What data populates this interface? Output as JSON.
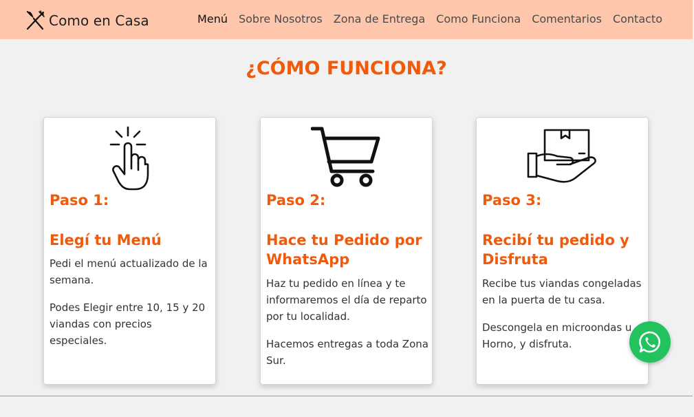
{
  "brand": {
    "name": "Como en Casa",
    "logo_icon": "fork-knife-icon"
  },
  "nav": {
    "items": [
      {
        "label": "Menú",
        "active": true
      },
      {
        "label": "Sobre Nosotros"
      },
      {
        "label": "Zona de Entrega"
      },
      {
        "label": "Como Funciona"
      },
      {
        "label": "Comentarios"
      },
      {
        "label": "Contacto"
      }
    ]
  },
  "section": {
    "title": "¿CÓMO FUNCIONA?"
  },
  "steps": [
    {
      "icon": "tap-hand-icon",
      "step": "Paso 1:",
      "title": "Elegí tu Menú",
      "paragraphs": [
        "Pedi el menú actualizado de la semana.",
        "Podes Elegir entre 10, 15 y 20 viandas con precios especiales."
      ]
    },
    {
      "icon": "shopping-cart-icon",
      "step": "Paso 2:",
      "title": "Hace tu Pedido por WhatsApp",
      "paragraphs": [
        "Haz tu pedido en línea y te informaremos el día de reparto por tu localidad.",
        "Hacemos entregas a toda Zona Sur."
      ]
    },
    {
      "icon": "box-in-hand-icon",
      "step": "Paso 3:",
      "title": "Recibí tu pedido y Disfruta",
      "paragraphs": [
        "Recibe tus viandas congeladas en la puerta de tu casa.",
        "Descongela en microondas u Horno, y disfruta."
      ]
    }
  ],
  "whatsapp": {
    "icon": "whatsapp-icon"
  },
  "colors": {
    "navbar": "#fec7ab",
    "accent": "#f05a0a",
    "whatsapp": "#22c35e",
    "background": "#f1f1f1"
  }
}
